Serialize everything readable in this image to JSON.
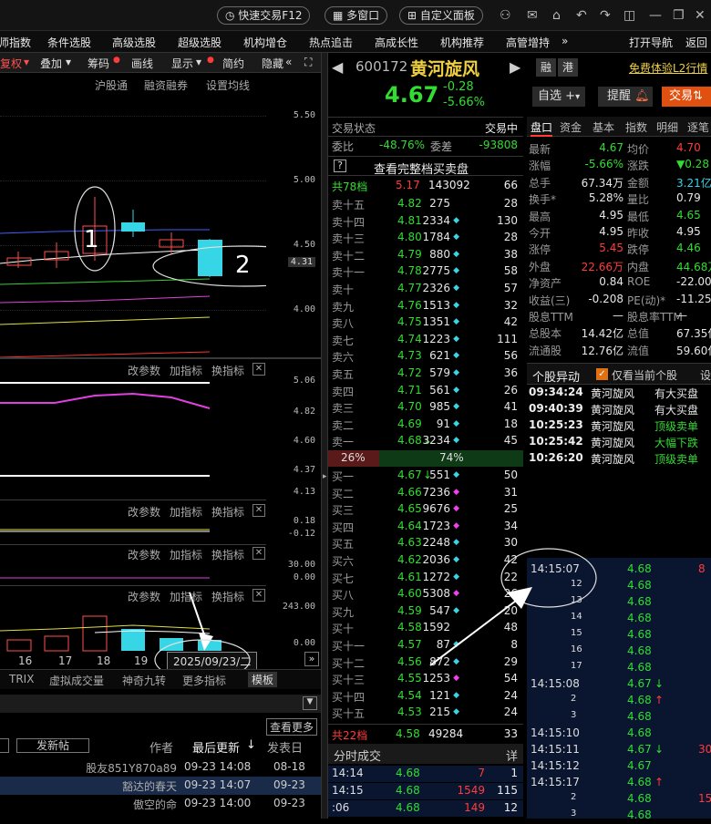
{
  "topbar": {
    "quick_trade": "快速交易F12",
    "multi_window": "多窗口",
    "custom_panel": "自定义面板",
    "win_icons": [
      "user-icon",
      "mail-icon",
      "home-icon",
      "back-icon",
      "forward-icon",
      "skin-icon",
      "minimize-icon",
      "restore-icon",
      "close-icon"
    ]
  },
  "menu": [
    "师指数",
    "条件选股",
    "高级选股",
    "超级选股",
    "机构增仓",
    "热点追击",
    "高成长性",
    "机构推荐",
    "高管增持",
    "»",
    "打开导航",
    "返回"
  ],
  "chart_toolbar": [
    "复权",
    "叠加",
    "筹码",
    "画线",
    "显示",
    "简约",
    "隐藏"
  ],
  "chart_sub_tabs": [
    "沪股通",
    "融资融券",
    "设置均线"
  ],
  "price_axis": [
    "5.50",
    "5.00",
    "4.50",
    "4.31",
    "4.00"
  ],
  "ind1": {
    "tabs": [
      "改参数",
      "加指标",
      "换指标"
    ],
    "axis": [
      "5.06",
      "4.82",
      "4.60",
      "4.37",
      "4.13"
    ]
  },
  "ind2": {
    "tabs": [
      "改参数",
      "加指标",
      "换指标"
    ],
    "axis": [
      "0.18",
      "-0.12"
    ]
  },
  "ind3": {
    "tabs": [
      "改参数",
      "加指标",
      "换指标"
    ],
    "axis": [
      "30.00",
      "0.00"
    ]
  },
  "ind4": {
    "tabs": [
      "改参数",
      "加指标",
      "换指标"
    ],
    "axis": [
      "243.00",
      "0.00"
    ]
  },
  "date_axis": [
    "16",
    "17",
    "18",
    "19"
  ],
  "date_label": "2025/09/23/二",
  "bottom_tabs": [
    "TRIX",
    "虚拟成交量",
    "神奇九转",
    "更多指标",
    "模板"
  ],
  "annotations": [
    "1",
    "2"
  ],
  "forum": {
    "view_more": "查看更多",
    "post": "发新帖",
    "header": [
      "作者",
      "最后更新",
      "发表日"
    ],
    "rows": [
      {
        "author": "股友851Y870a89",
        "updated": "09-23 14:08",
        "posted": "08-18"
      },
      {
        "author": "豁达的春天",
        "updated": "09-23 14:07",
        "posted": "09-23"
      },
      {
        "author": "傲空的命",
        "updated": "09-23 14:00",
        "posted": "09-23"
      }
    ]
  },
  "stock": {
    "code": "600172",
    "name": "黄河旋风",
    "price": "4.67",
    "change": "-0.28",
    "pct": "-5.66%",
    "tags": [
      "融",
      "港"
    ],
    "promo": "免费体验L2行情"
  },
  "trade_status": {
    "label": "交易状态",
    "value": "交易中"
  },
  "ratio": {
    "wb_label": "委比",
    "wb": "-48.76%",
    "wc_label": "委差",
    "wc": "-93808",
    "full_book": "查看完整档买卖盘"
  },
  "sell_header": {
    "label": "共78档",
    "price": "5.17",
    "vol": "143092",
    "count": "66"
  },
  "sells": [
    {
      "lbl": "卖十五",
      "p": "4.82",
      "v": "275",
      "m": "",
      "c": "28"
    },
    {
      "lbl": "卖十四",
      "p": "4.81",
      "v": "2334",
      "m": "c",
      "c": "130"
    },
    {
      "lbl": "卖十三",
      "p": "4.80",
      "v": "1784",
      "m": "c",
      "c": "28"
    },
    {
      "lbl": "卖十二",
      "p": "4.79",
      "v": "880",
      "m": "c",
      "c": "38"
    },
    {
      "lbl": "卖十一",
      "p": "4.78",
      "v": "2775",
      "m": "c",
      "c": "58"
    },
    {
      "lbl": "卖十",
      "p": "4.77",
      "v": "2326",
      "m": "c",
      "c": "57"
    },
    {
      "lbl": "卖九",
      "p": "4.76",
      "v": "1513",
      "m": "c",
      "c": "32"
    },
    {
      "lbl": "卖八",
      "p": "4.75",
      "v": "1351",
      "m": "c",
      "c": "42"
    },
    {
      "lbl": "卖七",
      "p": "4.74",
      "v": "1223",
      "m": "c",
      "c": "111"
    },
    {
      "lbl": "卖六",
      "p": "4.73",
      "v": "621",
      "m": "c",
      "c": "56"
    },
    {
      "lbl": "卖五",
      "p": "4.72",
      "v": "579",
      "m": "c",
      "c": "36"
    },
    {
      "lbl": "卖四",
      "p": "4.71",
      "v": "561",
      "m": "c",
      "c": "26"
    },
    {
      "lbl": "卖三",
      "p": "4.70",
      "v": "985",
      "m": "c",
      "c": "41"
    },
    {
      "lbl": "卖二",
      "p": "4.69",
      "v": "91",
      "m": "c",
      "c": "18"
    },
    {
      "lbl": "卖一",
      "p": "4.68",
      "v": "3234",
      "m": "c",
      "c": "45",
      "arrow": "↓"
    }
  ],
  "split": {
    "buy": "26%",
    "sell": "74%"
  },
  "buys": [
    {
      "lbl": "买一",
      "p": "4.67",
      "v": "551",
      "m": "c",
      "c": "50",
      "arrow": "↓"
    },
    {
      "lbl": "买二",
      "p": "4.66",
      "v": "7236",
      "m": "m",
      "c": "31"
    },
    {
      "lbl": "买三",
      "p": "4.65",
      "v": "9676",
      "m": "m",
      "c": "25"
    },
    {
      "lbl": "买四",
      "p": "4.64",
      "v": "1723",
      "m": "m",
      "c": "34"
    },
    {
      "lbl": "买五",
      "p": "4.63",
      "v": "2248",
      "m": "c",
      "c": "30"
    },
    {
      "lbl": "买六",
      "p": "4.62",
      "v": "2036",
      "m": "c",
      "c": "42"
    },
    {
      "lbl": "买七",
      "p": "4.61",
      "v": "1272",
      "m": "c",
      "c": "22"
    },
    {
      "lbl": "买八",
      "p": "4.60",
      "v": "5308",
      "m": "m",
      "c": "26"
    },
    {
      "lbl": "买九",
      "p": "4.59",
      "v": "547",
      "m": "c",
      "c": "20"
    },
    {
      "lbl": "买十",
      "p": "4.58",
      "v": "1592",
      "m": "",
      "c": "48"
    },
    {
      "lbl": "买十一",
      "p": "4.57",
      "v": "87",
      "m": "c",
      "c": "8"
    },
    {
      "lbl": "买十二",
      "p": "4.56",
      "v": "872",
      "m": "c",
      "c": "29"
    },
    {
      "lbl": "买十三",
      "p": "4.55",
      "v": "1253",
      "m": "m",
      "c": "54"
    },
    {
      "lbl": "买十四",
      "p": "4.54",
      "v": "121",
      "m": "c",
      "c": "24"
    },
    {
      "lbl": "买十五",
      "p": "4.53",
      "v": "215",
      "m": "c",
      "c": "24"
    }
  ],
  "buy_footer": {
    "label": "共22档",
    "price": "4.58",
    "vol": "49284",
    "count": "33"
  },
  "ticks_header": {
    "label": "分时成交",
    "more": "详"
  },
  "mid_ticks": [
    {
      "t": "14:14",
      "p": "4.68",
      "v": "7",
      "n": "1"
    },
    {
      "t": "14:15",
      "p": "4.68",
      "v": "1549",
      "n": "115"
    },
    {
      "t": ":06",
      "p": "4.68",
      "v": "149",
      "n": "12"
    }
  ],
  "right_buttons": {
    "watch": "自选",
    "alert": "提醒",
    "trade": "交易"
  },
  "right_tabs": [
    "盘口",
    "资金",
    "基本",
    "指数",
    "明细",
    "逐笔"
  ],
  "stats": [
    {
      "l1": "最新",
      "v1": "4.67",
      "c1": "grn",
      "l2": "均价",
      "v2": "4.70",
      "c2": "red"
    },
    {
      "l1": "涨幅",
      "v1": "-5.66%",
      "c1": "grn",
      "l2": "涨跌",
      "v2": "▼0.28",
      "c2": "grn"
    },
    {
      "l1": "总手",
      "v1": "67.34万",
      "c1": "wht",
      "l2": "金额",
      "v2": "3.21亿",
      "c2": "cy"
    },
    {
      "l1": "换手*",
      "v1": "5.28%",
      "c1": "wht",
      "l2": "量比",
      "v2": "0.79",
      "c2": "wht"
    },
    {
      "l1": "最高",
      "v1": "4.95",
      "c1": "wht",
      "l2": "最低",
      "v2": "4.65",
      "c2": "grn"
    },
    {
      "l1": "今开",
      "v1": "4.95",
      "c1": "wht",
      "l2": "昨收",
      "v2": "4.95",
      "c2": "wht"
    },
    {
      "l1": "涨停",
      "v1": "5.45",
      "c1": "red",
      "l2": "跌停",
      "v2": "4.46",
      "c2": "grn"
    },
    {
      "l1": "外盘",
      "v1": "22.66万",
      "c1": "red",
      "l2": "内盘",
      "v2": "44.68万",
      "c2": "grn"
    },
    {
      "l1": "净资产",
      "v1": "0.84",
      "c1": "wht",
      "l2": "ROE",
      "v2": "-22.00%",
      "c2": "wht"
    },
    {
      "l1": "收益(三)",
      "v1": "-0.208",
      "c1": "wht",
      "l2": "PE(动)*",
      "v2": "-11.25",
      "c2": "wht"
    },
    {
      "l1": "股息TTM",
      "v1": "—",
      "c1": "wht",
      "l2": "股息率TTM",
      "v2": "—",
      "c2": "wht"
    },
    {
      "l1": "总股本",
      "v1": "14.42亿",
      "c1": "wht",
      "l2": "总值",
      "v2": "67.35亿",
      "c2": "wht"
    },
    {
      "l1": "流通股",
      "v1": "12.76亿",
      "c1": "wht",
      "l2": "流值",
      "v2": "59.60亿",
      "c2": "wht"
    }
  ],
  "anomaly": {
    "title": "个股异动",
    "only_current": "仅看当前个股",
    "settings": "设",
    "rows": [
      {
        "t": "09:34:24",
        "n": "黄河旋风",
        "e": "有大买盘",
        "c": "wht"
      },
      {
        "t": "09:40:39",
        "n": "黄河旋风",
        "e": "有大买盘",
        "c": "wht"
      },
      {
        "t": "10:25:23",
        "n": "黄河旋风",
        "e": "顶级卖单",
        "c": "grn"
      },
      {
        "t": "10:25:42",
        "n": "黄河旋风",
        "e": "大幅下跌",
        "c": "grn"
      },
      {
        "t": "10:26:20",
        "n": "黄河旋风",
        "e": "顶级卖单",
        "c": "grn"
      }
    ]
  },
  "right_ticks": [
    {
      "t": "14:15:07",
      "p": "4.68",
      "a": "",
      "v": "8"
    },
    {
      "t": "12",
      "p": "4.68",
      "a": "",
      "v": ""
    },
    {
      "t": "13",
      "p": "4.68",
      "a": "",
      "v": ""
    },
    {
      "t": "14",
      "p": "4.68",
      "a": "",
      "v": ""
    },
    {
      "t": "15",
      "p": "4.68",
      "a": "",
      "v": ""
    },
    {
      "t": "16",
      "p": "4.68",
      "a": "",
      "v": ""
    },
    {
      "t": "17",
      "p": "4.68",
      "a": "",
      "v": ""
    },
    {
      "t": "14:15:08",
      "p": "4.67",
      "a": "↓",
      "v": ""
    },
    {
      "t": "2",
      "p": "4.68",
      "a": "↑",
      "v": ""
    },
    {
      "t": "3",
      "p": "4.68",
      "a": "",
      "v": ""
    },
    {
      "t": "14:15:10",
      "p": "4.68",
      "a": "",
      "v": ""
    },
    {
      "t": "14:15:11",
      "p": "4.67",
      "a": "↓",
      "v": "30"
    },
    {
      "t": "14:15:12",
      "p": "4.67",
      "a": "",
      "v": ""
    },
    {
      "t": "14:15:17",
      "p": "4.68",
      "a": "↑",
      "v": ""
    },
    {
      "t": "2",
      "p": "4.68",
      "a": "",
      "v": "15"
    },
    {
      "t": "3",
      "p": "4.68",
      "a": "",
      "v": ""
    }
  ]
}
